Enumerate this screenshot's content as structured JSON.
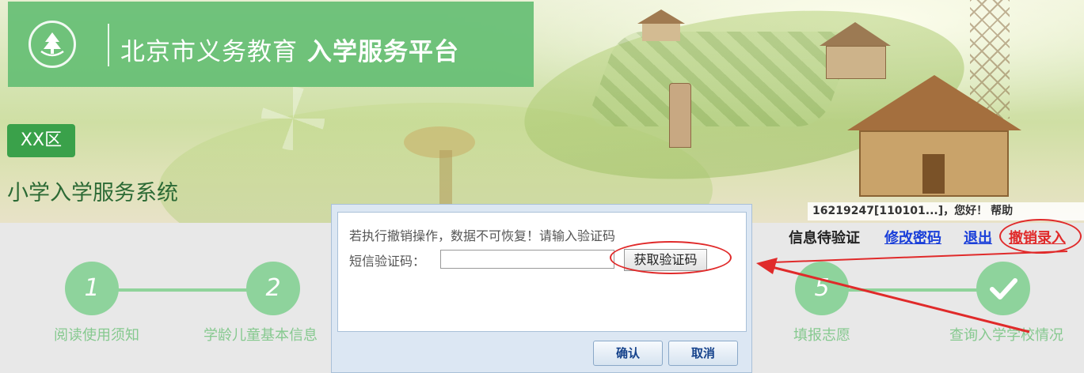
{
  "header": {
    "platform_name": "北京市义务教育",
    "platform_suffix": "入学服务平台",
    "district": "XX区",
    "system_title": "小学入学服务系统"
  },
  "userbar": {
    "user": "16219247[110101...]，您好！",
    "help": "帮助"
  },
  "nav": {
    "status": "信息待验证",
    "edit_password": "修改密码",
    "logout": "退出",
    "cancel_entry": "撤销录入"
  },
  "steps": [
    {
      "number": "1",
      "label": "阅读使用须知"
    },
    {
      "number": "2",
      "label": "学龄儿童基本信息"
    },
    {
      "number": "5",
      "label": "填报志愿"
    },
    {
      "number": "✓",
      "label": "查询入学学校情况"
    }
  ],
  "modal": {
    "message": "若执行撤销操作，数据不可恢复！请输入验证码",
    "sms_label": "短信验证码：",
    "sms_value": "",
    "get_code_label": "获取验证码",
    "confirm_label": "确认",
    "cancel_label": "取消"
  },
  "colors": {
    "brand_green": "#66be74",
    "district_green": "#3aa14a",
    "link_blue": "#1a3fd9",
    "highlight_red": "#e02a2a"
  }
}
